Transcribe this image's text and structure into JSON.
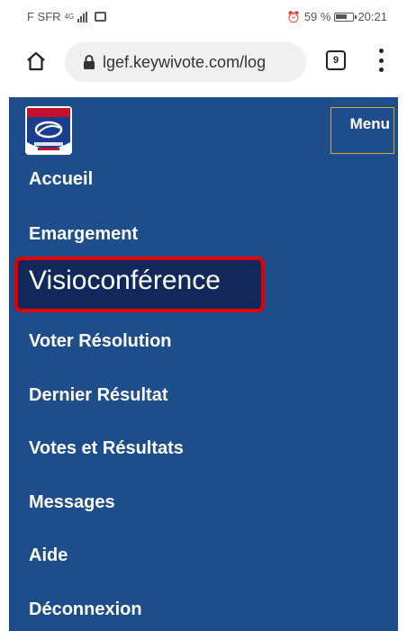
{
  "status_bar": {
    "carrier": "F SFR",
    "network": "4G",
    "alarm": "⏰",
    "battery": "59 %",
    "time": "20:21"
  },
  "browser": {
    "url": "lgef.keywivote.com/log",
    "tab_count": "9"
  },
  "header": {
    "menu_label": "Menu"
  },
  "nav": {
    "items": [
      {
        "label": "Accueil"
      },
      {
        "label": "Emargement"
      },
      {
        "label": "Visioconférence"
      },
      {
        "label": "Voter Résolution"
      },
      {
        "label": "Dernier Résultat"
      },
      {
        "label": "Votes et Résultats"
      },
      {
        "label": "Messages"
      },
      {
        "label": "Aide"
      },
      {
        "label": "Déconnexion"
      }
    ]
  },
  "colors": {
    "page_bg": "#1e4d8c",
    "highlight_border": "#e00000",
    "highlight_bg": "#13285a",
    "menu_border": "#d6a73a",
    "side_tab": "#92d050"
  }
}
